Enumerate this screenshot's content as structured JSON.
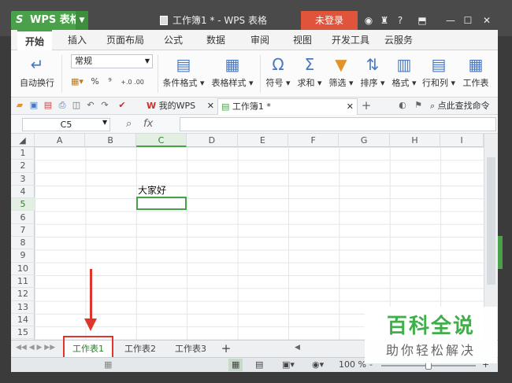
{
  "app": {
    "name": "WPS 表格",
    "logo_letter": "S"
  },
  "window": {
    "title": "工作簿1 * - WPS 表格",
    "login_label": "未登录",
    "help_label": "?"
  },
  "ribbon_tabs": [
    {
      "label": "开始"
    },
    {
      "label": "插入"
    },
    {
      "label": "页面布局"
    },
    {
      "label": "公式"
    },
    {
      "label": "数据"
    },
    {
      "label": "审阅"
    },
    {
      "label": "视图"
    },
    {
      "label": "开发工具"
    },
    {
      "label": "云服务"
    }
  ],
  "ribbon": {
    "wrap_text": "自动换行",
    "number_format": "常规",
    "percent": "%",
    "comma": "⁹",
    "dec_inc": "+.0 .00",
    "dec_dec": "+.0 .00",
    "buttons": [
      {
        "label": "条件格式 ▾"
      },
      {
        "label": "表格样式 ▾"
      },
      {
        "label": "符号 ▾"
      },
      {
        "label": "求和 ▾"
      },
      {
        "label": "筛选 ▾"
      },
      {
        "label": "排序 ▾"
      },
      {
        "label": "格式 ▾"
      },
      {
        "label": "行和列 ▾"
      },
      {
        "label": "工作表"
      }
    ]
  },
  "doc_tabs": [
    {
      "label": "我的WPS"
    },
    {
      "label": "工作簿1 *"
    }
  ],
  "search": {
    "label": "点此查找命令"
  },
  "formula_bar": {
    "name_box": "C5",
    "fx": "fx",
    "value": ""
  },
  "columns": [
    "A",
    "B",
    "C",
    "D",
    "E",
    "F",
    "G",
    "H",
    "I"
  ],
  "rows": [
    "1",
    "2",
    "3",
    "4",
    "5",
    "6",
    "7",
    "8",
    "9",
    "10",
    "11",
    "12",
    "13",
    "14",
    "15"
  ],
  "cells": {
    "C4": "大家好"
  },
  "active_cell": "C5",
  "sheets": [
    {
      "label": "工作表1"
    },
    {
      "label": "工作表2"
    },
    {
      "label": "工作表3"
    }
  ],
  "add_sheet": "+",
  "status": {
    "zoom": "100 %",
    "minus": "-",
    "plus": "+"
  },
  "watermark": {
    "line1": "百科全说",
    "line2": "助你轻松解决"
  },
  "colors": {
    "accent": "#4aa14a",
    "highlight": "#e0352b",
    "login": "#e0543c"
  }
}
